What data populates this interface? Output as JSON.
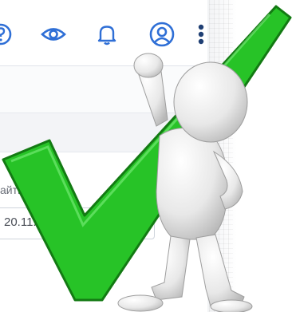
{
  "toolbar": {
    "icons": [
      "help-icon",
      "eye-icon",
      "bell-icon",
      "user-icon",
      "more-vertical-icon"
    ]
  },
  "form": {
    "date_label": "айти за     д:",
    "date_value": "20.11.201"
  },
  "colors": {
    "icon_blue": "#2f6fd6",
    "checkmark_green": "#27c327",
    "checkmark_outline": "#137a13",
    "figure_white": "#f2f2f2"
  }
}
